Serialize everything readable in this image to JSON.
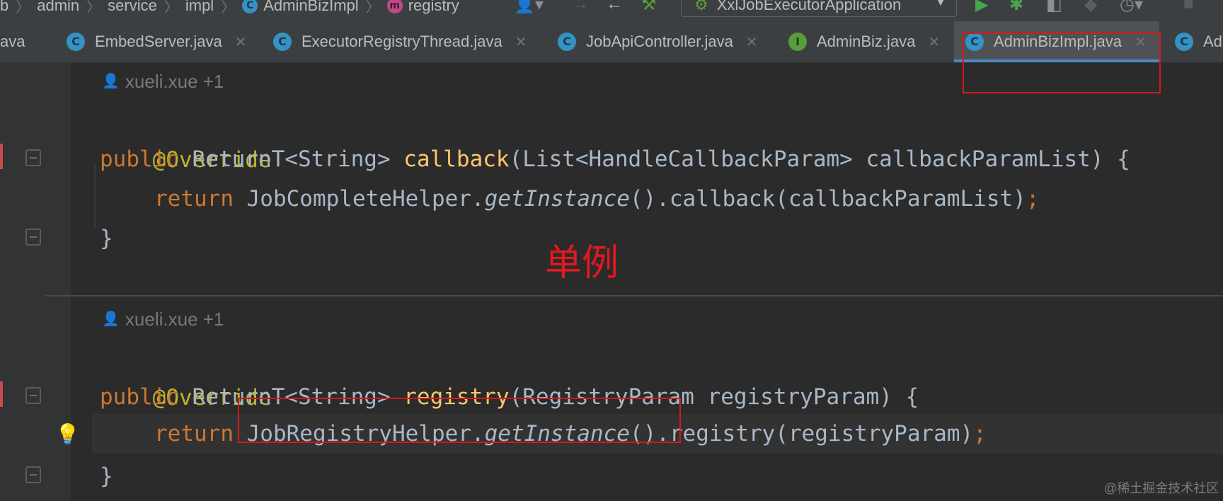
{
  "breadcrumb": {
    "items": [
      "b",
      "admin",
      "service",
      "impl",
      "AdminBizImpl",
      "registry"
    ]
  },
  "toolbar": {
    "run_config": "XxlJobExecutorApplication"
  },
  "tabs": [
    {
      "label": "ava",
      "icon": "class-icon"
    },
    {
      "label": "EmbedServer.java",
      "icon": "class-icon"
    },
    {
      "label": "ExecutorRegistryThread.java",
      "icon": "class-icon"
    },
    {
      "label": "JobApiController.java",
      "icon": "class-icon"
    },
    {
      "label": "AdminBiz.java",
      "icon": "interface-icon"
    },
    {
      "label": "AdminBizImpl.java",
      "icon": "class-icon",
      "active": true
    },
    {
      "label": "Ad",
      "icon": "class-icon"
    }
  ],
  "code": {
    "author1": "xueli.xue +1",
    "override1": "@Override",
    "m1_public": "public",
    "m1_type": " ReturnT<String> ",
    "m1_name": "callback",
    "m1_params": "(List<HandleCallbackParam> callbackParamList) {",
    "m1_return": "return",
    "m1_helper": " JobCompleteHelper.",
    "m1_getinst": "getInstance",
    "m1_tail": "().callback(callbackParamList)",
    "semicolon": ";",
    "close_brace": "}",
    "author2": "xueli.xue +1",
    "override2": "@Override",
    "m2_public": "public",
    "m2_type": " ReturnT<String> ",
    "m2_name": "registry",
    "m2_params": "(RegistryParam registryParam) {",
    "m2_return": "return",
    "m2_helper": " JobRegistryHelper.",
    "m2_getinst": "getInstance",
    "m2_tail": "().registry(registryParam)"
  },
  "annotation": {
    "text": "单例",
    "color": "#e3191d"
  },
  "watermark": "@稀土掘金技术社区",
  "colors": {
    "keyword": "#cc7832",
    "annotation": "#bbb529",
    "method": "#ffc66d",
    "text": "#a9b7c6",
    "highlight_box": "#d11a1a",
    "active_tab_underline": "#4a88c7"
  }
}
